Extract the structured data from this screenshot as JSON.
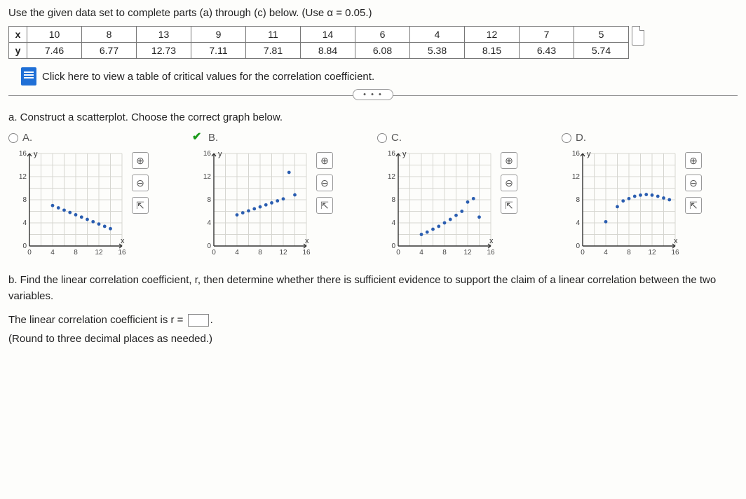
{
  "intro": "Use the given data set to complete parts (a) through (c) below. (Use α = 0.05.)",
  "table": {
    "row1_hdr": "x",
    "row2_hdr": "y",
    "x": [
      "10",
      "8",
      "13",
      "9",
      "11",
      "14",
      "6",
      "4",
      "12",
      "7",
      "5"
    ],
    "y": [
      "7.46",
      "6.77",
      "12.73",
      "7.11",
      "7.81",
      "8.84",
      "6.08",
      "5.38",
      "8.15",
      "6.43",
      "5.74"
    ]
  },
  "crit_link": "Click here to view a table of critical values for the correlation coefficient.",
  "dots": "• • •",
  "partA_q": "a. Construct a scatterplot. Choose the correct graph below.",
  "choices": {
    "a": "A.",
    "b": "B.",
    "c": "C.",
    "d": "D."
  },
  "zoom_in": "⊕",
  "zoom_out": "⊖",
  "open": "⇱",
  "axis": {
    "ylbl": "y",
    "xlbl": "x",
    "yt0": "0",
    "yt4": "4",
    "yt8": "8",
    "yt12": "12",
    "yt16": "16",
    "xt0": "0",
    "xt4": "4",
    "xt8": "8",
    "xt12": "12",
    "xt16": "16"
  },
  "partB_text": "b. Find the linear correlation coefficient, r, then determine whether there is sufficient evidence to support the claim of a linear correlation between the two variables.",
  "partB_ans_pre": "The linear correlation coefficient is r = ",
  "partB_ans_post": ".",
  "partB_round": "(Round to three decimal places as needed.)",
  "chart_data": [
    {
      "type": "scatter",
      "option": "A",
      "title": "",
      "xlabel": "x",
      "ylabel": "y",
      "xlim": [
        0,
        16
      ],
      "ylim": [
        0,
        16
      ],
      "points": [
        [
          4,
          7
        ],
        [
          5,
          6.6
        ],
        [
          6,
          6.2
        ],
        [
          7,
          5.8
        ],
        [
          8,
          5.4
        ],
        [
          9,
          5.0
        ],
        [
          10,
          4.6
        ],
        [
          11,
          4.2
        ],
        [
          12,
          3.8
        ],
        [
          13,
          3.4
        ],
        [
          14,
          3.0
        ]
      ]
    },
    {
      "type": "scatter",
      "option": "B",
      "title": "",
      "xlabel": "x",
      "ylabel": "y",
      "xlim": [
        0,
        16
      ],
      "ylim": [
        0,
        16
      ],
      "points": [
        [
          4,
          5.38
        ],
        [
          5,
          5.74
        ],
        [
          6,
          6.08
        ],
        [
          7,
          6.43
        ],
        [
          8,
          6.77
        ],
        [
          9,
          7.11
        ],
        [
          10,
          7.46
        ],
        [
          11,
          7.81
        ],
        [
          12,
          8.15
        ],
        [
          13,
          12.73
        ],
        [
          14,
          8.84
        ]
      ]
    },
    {
      "type": "scatter",
      "option": "C",
      "title": "",
      "xlabel": "x",
      "ylabel": "y",
      "xlim": [
        0,
        16
      ],
      "ylim": [
        0,
        16
      ],
      "points": [
        [
          4,
          2
        ],
        [
          5,
          2.4
        ],
        [
          6,
          2.9
        ],
        [
          7,
          3.4
        ],
        [
          8,
          4.0
        ],
        [
          9,
          4.6
        ],
        [
          10,
          5.3
        ],
        [
          11,
          6.0
        ],
        [
          12,
          7.6
        ],
        [
          13,
          8.2
        ],
        [
          14,
          5.0
        ]
      ]
    },
    {
      "type": "scatter",
      "option": "D",
      "title": "",
      "xlabel": "x",
      "ylabel": "y",
      "xlim": [
        0,
        16
      ],
      "ylim": [
        0,
        16
      ],
      "points": [
        [
          4,
          4.2
        ],
        [
          6,
          6.8
        ],
        [
          7,
          7.8
        ],
        [
          8,
          8.2
        ],
        [
          9,
          8.6
        ],
        [
          10,
          8.8
        ],
        [
          11,
          8.9
        ],
        [
          12,
          8.8
        ],
        [
          13,
          8.6
        ],
        [
          14,
          8.3
        ],
        [
          15,
          8.0
        ]
      ]
    }
  ]
}
